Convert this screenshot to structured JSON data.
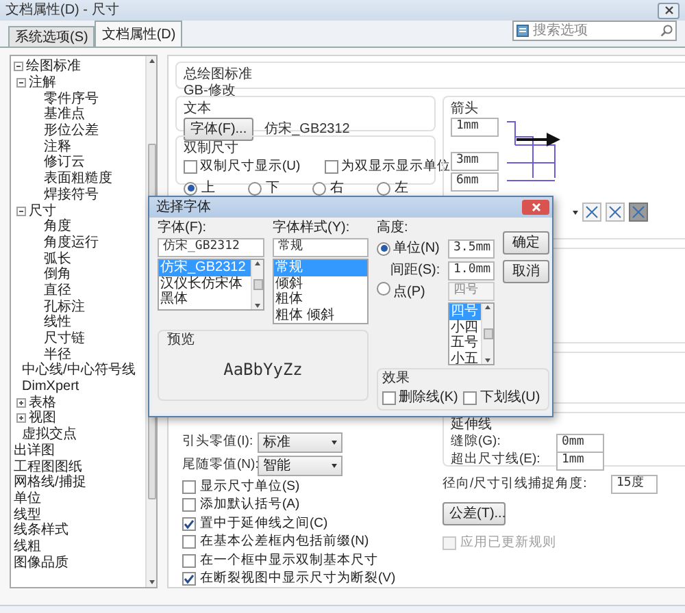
{
  "window": {
    "title": "文档属性(D) - 尺寸"
  },
  "tabs": [
    {
      "label": "系统选项(S)",
      "selected": false
    },
    {
      "label": "文档属性(D)",
      "selected": true
    }
  ],
  "search": {
    "placeholder": "搜索选项"
  },
  "tree": [
    {
      "label": "绘图标准",
      "selected": false,
      "expanded": true,
      "children": [
        {
          "label": "注解",
          "selected": false,
          "expanded": true,
          "children": [
            {
              "label": "零件序号",
              "selected": false
            },
            {
              "label": "基准点",
              "selected": false
            },
            {
              "label": "形位公差",
              "selected": false
            },
            {
              "label": "注释",
              "selected": false
            },
            {
              "label": "修订云",
              "selected": false
            },
            {
              "label": "表面粗糙度",
              "selected": false
            },
            {
              "label": "焊接符号",
              "selected": false
            }
          ]
        },
        {
          "label": "尺寸",
          "selected": false,
          "expanded": true,
          "children": [
            {
              "label": "角度",
              "selected": false
            },
            {
              "label": "角度运行",
              "selected": false
            },
            {
              "label": "弧长",
              "selected": false
            },
            {
              "label": "倒角",
              "selected": false
            },
            {
              "label": "直径",
              "selected": false
            },
            {
              "label": "孔标注",
              "selected": false
            },
            {
              "label": "线性",
              "selected": false
            },
            {
              "label": "尺寸链",
              "selected": false
            },
            {
              "label": "半径",
              "selected": false
            }
          ]
        },
        {
          "label": "中心线/中心符号线",
          "selected": false
        },
        {
          "label": "DimXpert",
          "selected": false
        },
        {
          "label": "表格",
          "selected": false,
          "expanded": false
        },
        {
          "label": "视图",
          "selected": false,
          "expanded": false
        },
        {
          "label": "虚拟交点",
          "selected": false
        }
      ]
    },
    {
      "label": "出详图",
      "selected": false
    },
    {
      "label": "工程图图纸",
      "selected": false
    },
    {
      "label": "网格线/捕捉",
      "selected": false
    },
    {
      "label": "单位",
      "selected": false
    },
    {
      "label": "线型",
      "selected": false
    },
    {
      "label": "线条样式",
      "selected": false
    },
    {
      "label": "线粗",
      "selected": false
    },
    {
      "label": "图像品质",
      "selected": false
    }
  ],
  "overall_standard": {
    "title": "总绘图标准",
    "value": "GB-修改"
  },
  "text_section": {
    "title": "文本",
    "font_button": "字体(F)...",
    "font_name": "仿宋_GB2312"
  },
  "dual": {
    "title": "双制尺寸",
    "checks": [
      {
        "label": "双制尺寸显示(U)",
        "checked": false
      },
      {
        "label": "为双显示显示单位",
        "checked": false
      }
    ],
    "positions": [
      {
        "label": "上",
        "selected": true
      },
      {
        "label": "下",
        "selected": false
      },
      {
        "label": "右",
        "selected": false
      },
      {
        "label": "左",
        "selected": false
      }
    ]
  },
  "arrows": {
    "title": "箭头",
    "fields": [
      "1mm",
      "3mm",
      "6mm"
    ]
  },
  "zeros": [
    {
      "label": "引头零值(I):",
      "value": "标准"
    },
    {
      "label": "尾随零值(N):",
      "value": "智能"
    }
  ],
  "options": [
    {
      "label": "显示尺寸单位(S)",
      "checked": false
    },
    {
      "label": "添加默认括号(A)",
      "checked": false
    },
    {
      "label": "置中于延伸线之间(C)",
      "checked": true
    },
    {
      "label": "在基本公差框内包括前缀(N)",
      "checked": false
    },
    {
      "label": "在一个框中显示双制基本尺寸",
      "checked": false
    },
    {
      "label": "在断裂视图中显示尺寸为断裂(V)",
      "checked": true
    }
  ],
  "extension": {
    "title": "延伸线",
    "fields": [
      {
        "label": "缝隙(G):",
        "value": "0mm"
      },
      {
        "label": "超出尺寸线(E):",
        "value": "1mm"
      }
    ]
  },
  "radial": {
    "label": "径向/尺寸引线捕捉角度:",
    "value": "15度"
  },
  "tolerance_button": "公差(T)...",
  "apply_rule": {
    "label": "应用已更新规则",
    "checked": false,
    "disabled": true
  },
  "font_dialog": {
    "title": "选择字体",
    "font": {
      "label": "字体(F):",
      "value": "仿宋_GB2312",
      "items": [
        {
          "label": "仿宋_GB2312",
          "selected": true
        },
        {
          "label": "汉仪长仿宋体",
          "selected": false
        },
        {
          "label": "黑体",
          "selected": false
        }
      ]
    },
    "style": {
      "label": "字体样式(Y):",
      "value": "常规",
      "items": [
        {
          "label": "常规",
          "selected": true
        },
        {
          "label": "倾斜",
          "selected": false
        },
        {
          "label": "粗体",
          "selected": false
        },
        {
          "label": "粗体 倾斜",
          "selected": false
        }
      ]
    },
    "height": {
      "label": "高度:",
      "units": {
        "label": "单位(N)",
        "selected": true,
        "value": "3.5mm"
      },
      "spacing": {
        "label": "间距(S):",
        "value": "1.0mm"
      },
      "points": {
        "label": "点(P)",
        "selected": false,
        "value": "四号",
        "items": [
          {
            "label": "四号",
            "selected": true
          },
          {
            "label": "小四",
            "selected": false
          },
          {
            "label": "五号",
            "selected": false
          },
          {
            "label": "小五",
            "selected": false
          }
        ]
      }
    },
    "buttons": [
      "确定",
      "取消"
    ],
    "preview": {
      "title": "预览",
      "sample": "AaBbYyZz"
    },
    "effects": {
      "title": "效果",
      "checks": [
        {
          "label": "删除线(K)",
          "checked": false
        },
        {
          "label": "下划线(U)",
          "checked": false
        }
      ]
    }
  }
}
